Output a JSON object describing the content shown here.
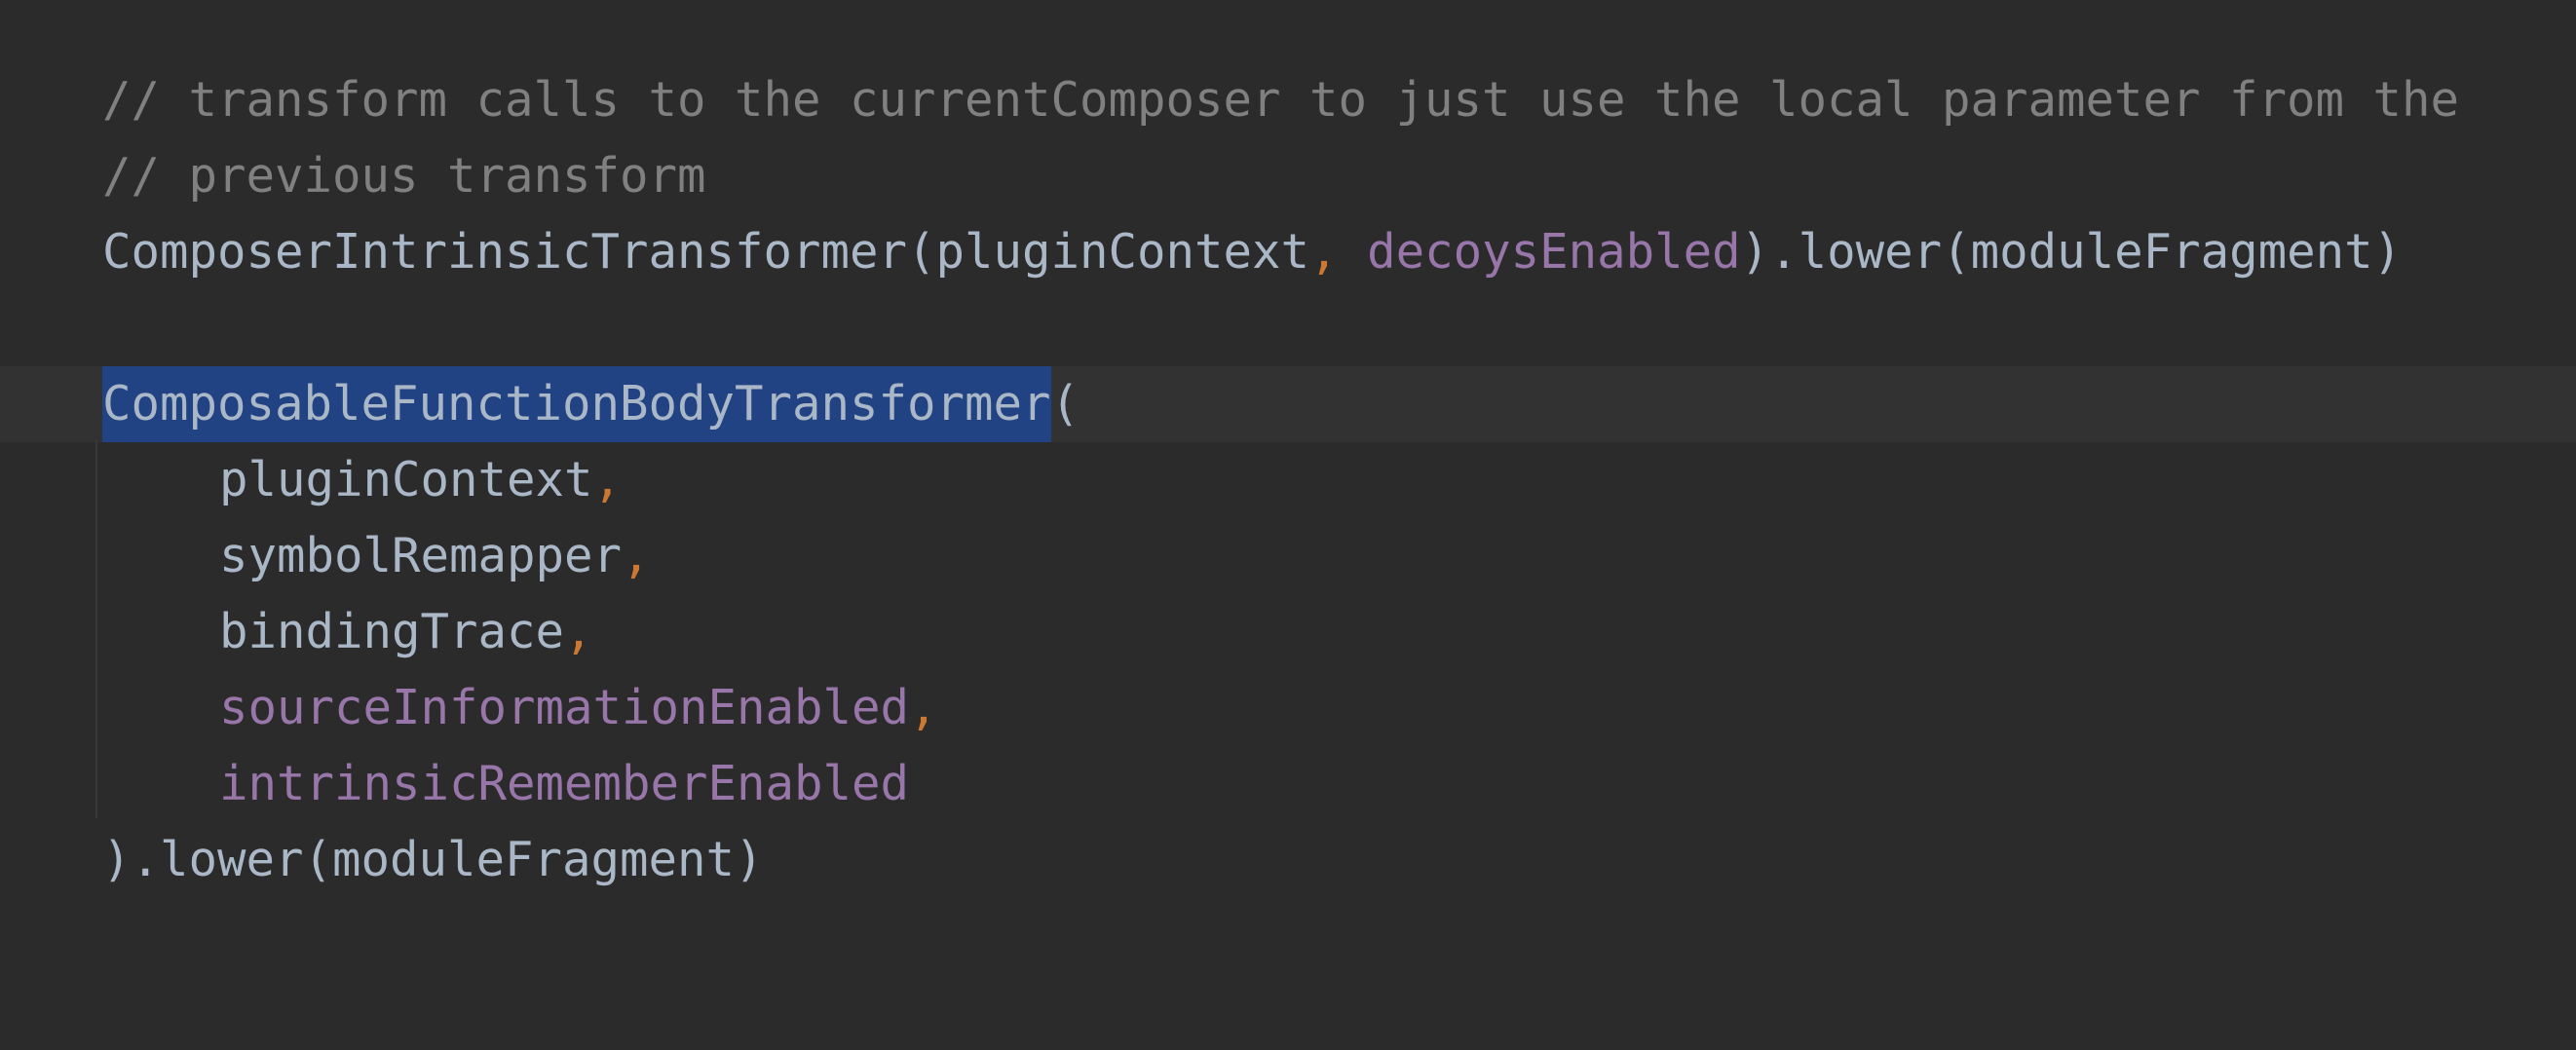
{
  "editor": {
    "lines": {
      "l1": {
        "comment": "// transform calls to the currentComposer to just use the local parameter from the"
      },
      "l2": {
        "comment": "// previous transform"
      },
      "l3": {
        "call": "ComposerIntrinsicTransformer(pluginContext",
        "comma": ",",
        "space": " ",
        "param": "decoysEnabled",
        "rest": ").lower(moduleFragment)"
      },
      "l5": {
        "selected": "ComposableFunctionBodyTransformer",
        "rest": "("
      },
      "l6": {
        "ident": "pluginContext",
        "comma": ","
      },
      "l7": {
        "ident": "symbolRemapper",
        "comma": ","
      },
      "l8": {
        "ident": "bindingTrace",
        "comma": ","
      },
      "l9": {
        "param": "sourceInformationEnabled",
        "comma": ","
      },
      "l10": {
        "param": "intrinsicRememberEnabled"
      },
      "l11": {
        "rest": ").lower(moduleFragment)"
      }
    },
    "colors": {
      "background": "#2b2b2b",
      "current_line": "#323232",
      "selection": "#214283",
      "comment": "#808080",
      "identifier": "#a9b7c6",
      "comma": "#cc7832",
      "parameter": "#9876aa"
    }
  }
}
